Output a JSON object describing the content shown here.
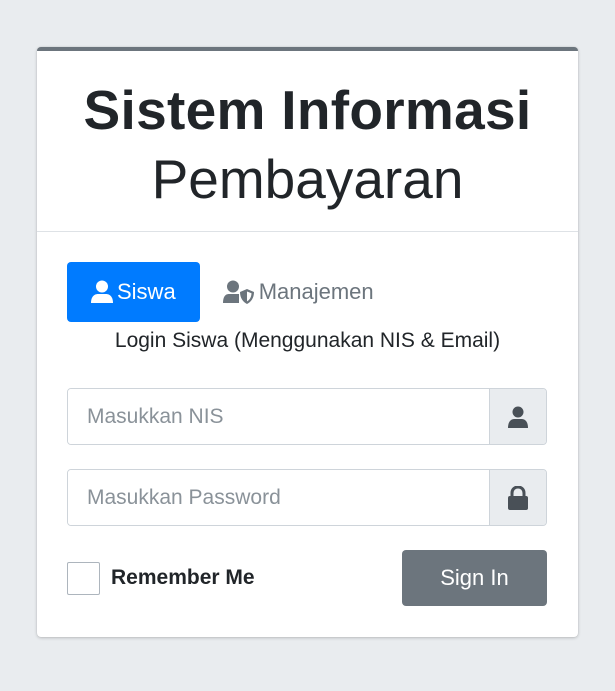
{
  "header": {
    "title_line1": "Sistem Informasi",
    "title_line2": "Pembayaran"
  },
  "tabs": [
    {
      "label": "Siswa",
      "icon": "user-icon",
      "active": true
    },
    {
      "label": "Manajemen",
      "icon": "user-shield-icon",
      "active": false
    }
  ],
  "subtitle": "Login Siswa (Menggunakan NIS & Email)",
  "form": {
    "nis": {
      "placeholder": "Masukkan NIS",
      "value": "",
      "icon": "user-icon"
    },
    "password": {
      "placeholder": "Masukkan Password",
      "value": "",
      "icon": "lock-icon"
    },
    "remember_label": "Remember Me",
    "remember_checked": false,
    "signin_label": "Sign In"
  },
  "colors": {
    "primary": "#007bff",
    "secondary": "#6c757d",
    "background": "#e9ecef"
  }
}
